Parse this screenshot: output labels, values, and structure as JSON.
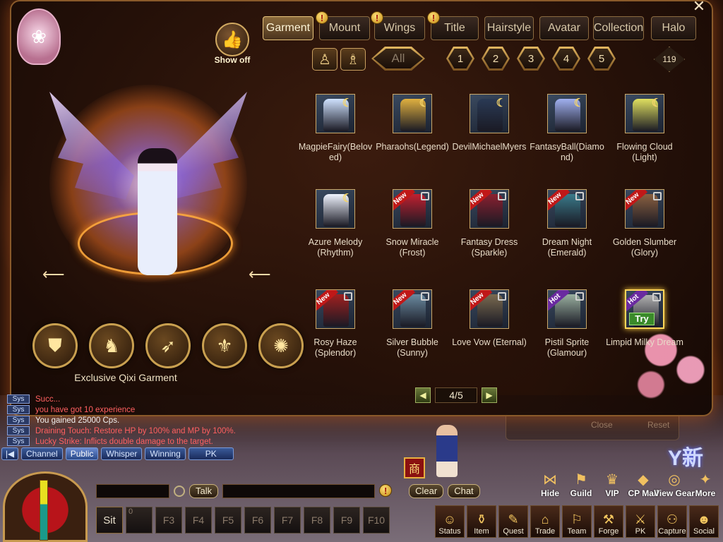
{
  "tabs": [
    {
      "label": "Garment",
      "active": true,
      "alert": false
    },
    {
      "label": "Mount",
      "active": false,
      "alert": true
    },
    {
      "label": "Wings",
      "active": false,
      "alert": true
    },
    {
      "label": "Title",
      "active": false,
      "alert": true
    },
    {
      "label": "Hairstyle",
      "active": false,
      "alert": false
    },
    {
      "label": "Avatar",
      "active": false,
      "alert": false
    },
    {
      "label": "Collection",
      "active": false,
      "alert": false
    },
    {
      "label": "Halo",
      "active": false,
      "alert": false
    }
  ],
  "alert_glyph": "!",
  "filters": {
    "all_label": "All",
    "tiers": [
      "1",
      "2",
      "3",
      "4",
      "5"
    ],
    "count": "119"
  },
  "show_off": {
    "label": "Show off",
    "icon": "thumbs-up-icon"
  },
  "items": [
    {
      "name": "MagpieFairy(Beloved)",
      "badge": "",
      "locked": false,
      "owned": true,
      "color": "#cfe2ff"
    },
    {
      "name": "Pharaohs(Legend)",
      "badge": "",
      "locked": false,
      "owned": true,
      "color": "#e0b040"
    },
    {
      "name": "DevilMichaelMyers",
      "badge": "",
      "locked": false,
      "owned": true,
      "color": "#2a3a55"
    },
    {
      "name": "FantasyBall(Diamond)",
      "badge": "",
      "locked": false,
      "owned": true,
      "color": "#a0b0f0"
    },
    {
      "name": "Flowing Cloud (Light)",
      "badge": "",
      "locked": false,
      "owned": true,
      "color": "#e0e060"
    },
    {
      "name": "Azure Melody (Rhythm)",
      "badge": "",
      "locked": false,
      "owned": true,
      "color": "#f0f4ff"
    },
    {
      "name": "Snow Miracle (Frost)",
      "badge": "New",
      "locked": true,
      "owned": false,
      "color": "#c02030"
    },
    {
      "name": "Fantasy Dress (Sparkle)",
      "badge": "New",
      "locked": true,
      "owned": false,
      "color": "#8a2030"
    },
    {
      "name": "Dream Night (Emerald)",
      "badge": "New",
      "locked": true,
      "owned": false,
      "color": "#3a7a8a"
    },
    {
      "name": "Golden Slumber (Glory)",
      "badge": "New",
      "locked": true,
      "owned": false,
      "color": "#8a6040"
    },
    {
      "name": "Rosy Haze (Splendor)",
      "badge": "New",
      "locked": true,
      "owned": false,
      "color": "#a02020"
    },
    {
      "name": "Silver Bubble (Sunny)",
      "badge": "New",
      "locked": true,
      "owned": false,
      "color": "#6a8aa0"
    },
    {
      "name": "Love Vow (Eternal)",
      "badge": "New",
      "locked": true,
      "owned": false,
      "color": "#7a6a50"
    },
    {
      "name": "Pistil Sprite (Glamour)",
      "badge": "Hot",
      "locked": true,
      "owned": false,
      "color": "#9ab0a0"
    },
    {
      "name": "Limpid Milky Dream",
      "badge": "Hot",
      "locked": true,
      "owned": false,
      "selected": true,
      "try_label": "Try",
      "color": "#b0b0b0"
    }
  ],
  "pager": {
    "current": "4/5",
    "prev_icon": "triangle-left-icon",
    "next_icon": "triangle-right-icon"
  },
  "category": {
    "label": "Exclusive Qixi Garment",
    "buttons": [
      {
        "name": "garment-category",
        "icon": "armor-icon",
        "glyph": "⛊"
      },
      {
        "name": "mount-category",
        "icon": "horse-icon",
        "glyph": "♞"
      },
      {
        "name": "wings-category",
        "icon": "wing-icon",
        "glyph": "➶"
      },
      {
        "name": "title-category",
        "icon": "fleur-icon",
        "glyph": "⚜"
      },
      {
        "name": "halo-category",
        "icon": "swirl-icon",
        "glyph": "✺"
      }
    ]
  },
  "chat": {
    "lines": [
      {
        "tag": "Sys",
        "text": "Succ...",
        "color": "red"
      },
      {
        "tag": "Sys",
        "text": "you have got 10 experience",
        "color": "red"
      },
      {
        "tag": "Sys",
        "text": "You gained 25000 Cps.",
        "color": "white"
      },
      {
        "tag": "Sys",
        "text": "Draining Touch: Restore HP by 100% and MP by 100%.",
        "color": "red"
      },
      {
        "tag": "Sys",
        "text": "Lucky Strike: Inflicts double damage to the target.",
        "color": "red"
      }
    ],
    "tabs": [
      "Channel",
      "Public",
      "Whisper",
      "Winning",
      "PK"
    ],
    "talk_label": "Talk",
    "clear_label": "Clear",
    "chat_label": "Chat"
  },
  "skills": {
    "sit_label": "Sit",
    "slot_count": "0",
    "fkeys": [
      "F3",
      "F4",
      "F5",
      "F6",
      "F7",
      "F8",
      "F9",
      "F10"
    ]
  },
  "menu_top": [
    {
      "label": "Hide",
      "icon": "hide-icon",
      "glyph": "⋈"
    },
    {
      "label": "Guild",
      "icon": "guild-icon",
      "glyph": "⚑"
    },
    {
      "label": "VIP",
      "icon": "vip-icon",
      "glyph": "♛"
    },
    {
      "label": "CP Mall",
      "icon": "diamond-icon",
      "glyph": "◆"
    },
    {
      "label": "View Gear",
      "icon": "ring-icon",
      "glyph": "◎"
    },
    {
      "label": "More",
      "icon": "more-icon",
      "glyph": "✦"
    }
  ],
  "menu_bottom": [
    {
      "label": "Status",
      "icon": "status-icon",
      "glyph": "☺"
    },
    {
      "label": "Item",
      "icon": "bag-icon",
      "glyph": "⚱"
    },
    {
      "label": "Quest",
      "icon": "scroll-icon",
      "glyph": "✎"
    },
    {
      "label": "Trade",
      "icon": "chest-icon",
      "glyph": "⌂"
    },
    {
      "label": "Team",
      "icon": "team-icon",
      "glyph": "⚐"
    },
    {
      "label": "Forge",
      "icon": "anvil-icon",
      "glyph": "⚒"
    },
    {
      "label": "PK",
      "icon": "swords-icon",
      "glyph": "⚔"
    },
    {
      "label": "Capture",
      "icon": "capture-icon",
      "glyph": "⚇"
    },
    {
      "label": "Social",
      "icon": "social-icon",
      "glyph": "☻"
    }
  ],
  "misc": {
    "shop_glyph": "商",
    "xin_glyph": "Y新",
    "ghost_close": "Close",
    "ghost_reset": "Reset",
    "close_glyph": "✕",
    "lantern_glyph": "❀"
  }
}
